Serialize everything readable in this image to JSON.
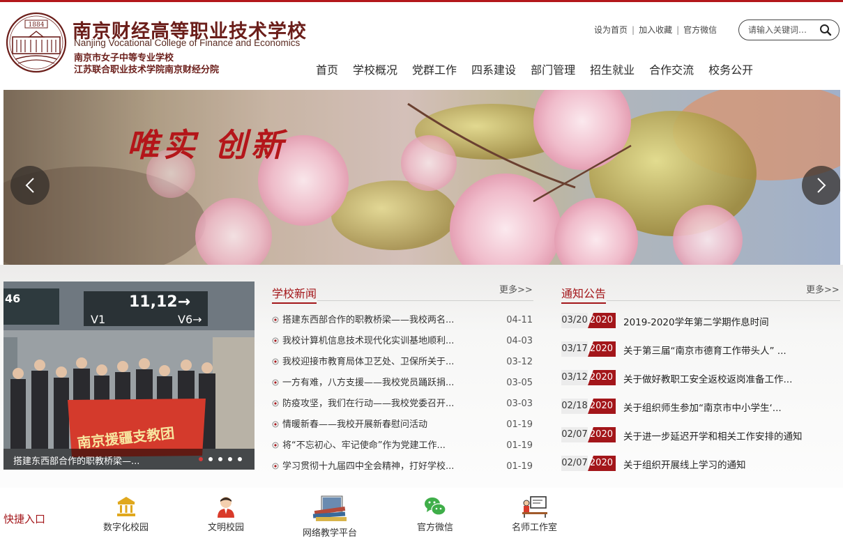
{
  "header": {
    "logo_year": "1884",
    "school_name_cn": "南京财经高等职业技术学校",
    "school_name_en": "Nanjing Vocational College of Finance and Economics",
    "sub_name_1": "南京市女子中等专业学校",
    "sub_name_2": "江苏联合职业技术学院南京财经分院",
    "top_links": [
      "设为首页",
      "加入收藏",
      "官方微信"
    ],
    "search_placeholder": "请输入关键词…"
  },
  "nav": [
    "首页",
    "学校概况",
    "党群工作",
    "四系建设",
    "部门管理",
    "招生就业",
    "合作交流",
    "校务公开"
  ],
  "banner": {
    "slogan": "唯实 创新"
  },
  "photo_news": {
    "caption": "搭建东西部合作的职教桥梁—...",
    "slide_count": 5,
    "active_slide": 1
  },
  "school_news": {
    "title": "学校新闻",
    "more": "更多>>",
    "items": [
      {
        "title": "搭建东西部合作的职教桥梁——我校两名...",
        "date": "04-11"
      },
      {
        "title": "我校计算机信息技术现代化实训基地顺利...",
        "date": "04-03"
      },
      {
        "title": "我校迎接市教育局体卫艺处、卫保所关于...",
        "date": "03-12"
      },
      {
        "title": "一方有难，八方支援——我校党员踊跃捐...",
        "date": "03-05"
      },
      {
        "title": "防疫攻坚，我们在行动——我校党委召开...",
        "date": "03-03"
      },
      {
        "title": "情暖新春——我校开展新春慰问活动",
        "date": "01-19"
      },
      {
        "title": "将“不忘初心、牢记使命”作为党建工作...",
        "date": "01-19"
      },
      {
        "title": "学习贯彻十九届四中全会精神，打好学校...",
        "date": "01-19"
      }
    ]
  },
  "notices": {
    "title": "通知公告",
    "more": "更多>>",
    "items": [
      {
        "md": "03/20",
        "year": "2020",
        "title": "2019-2020学年第二学期作息时间"
      },
      {
        "md": "03/17",
        "year": "2020",
        "title": "关于第三届“南京市德育工作带头人” ..."
      },
      {
        "md": "03/12",
        "year": "2020",
        "title": "关于做好教职工安全返校返岗准备工作..."
      },
      {
        "md": "02/18",
        "year": "2020",
        "title": "关于组织师生参加“南京市中小学生‘..."
      },
      {
        "md": "02/07",
        "year": "2020",
        "title": "关于进一步延迟开学和相关工作安排的通知"
      },
      {
        "md": "02/07",
        "year": "2020",
        "title": "关于组织开展线上学习的通知"
      }
    ]
  },
  "quick_entry": {
    "label": "快捷入口",
    "items": [
      {
        "label": "数字化校园",
        "icon": "bank-building-icon"
      },
      {
        "label": "文明校园",
        "icon": "person-avatar-icon"
      },
      {
        "label": "网络教学平台",
        "icon": "books-icon"
      },
      {
        "label": "官方微信",
        "icon": "wechat-icon"
      },
      {
        "label": "名师工作室",
        "icon": "teacher-desk-icon"
      }
    ]
  },
  "colors": {
    "brand_red": "#a3161a",
    "top_border": "#b3171b",
    "brand_brown": "#6b1e1a"
  }
}
